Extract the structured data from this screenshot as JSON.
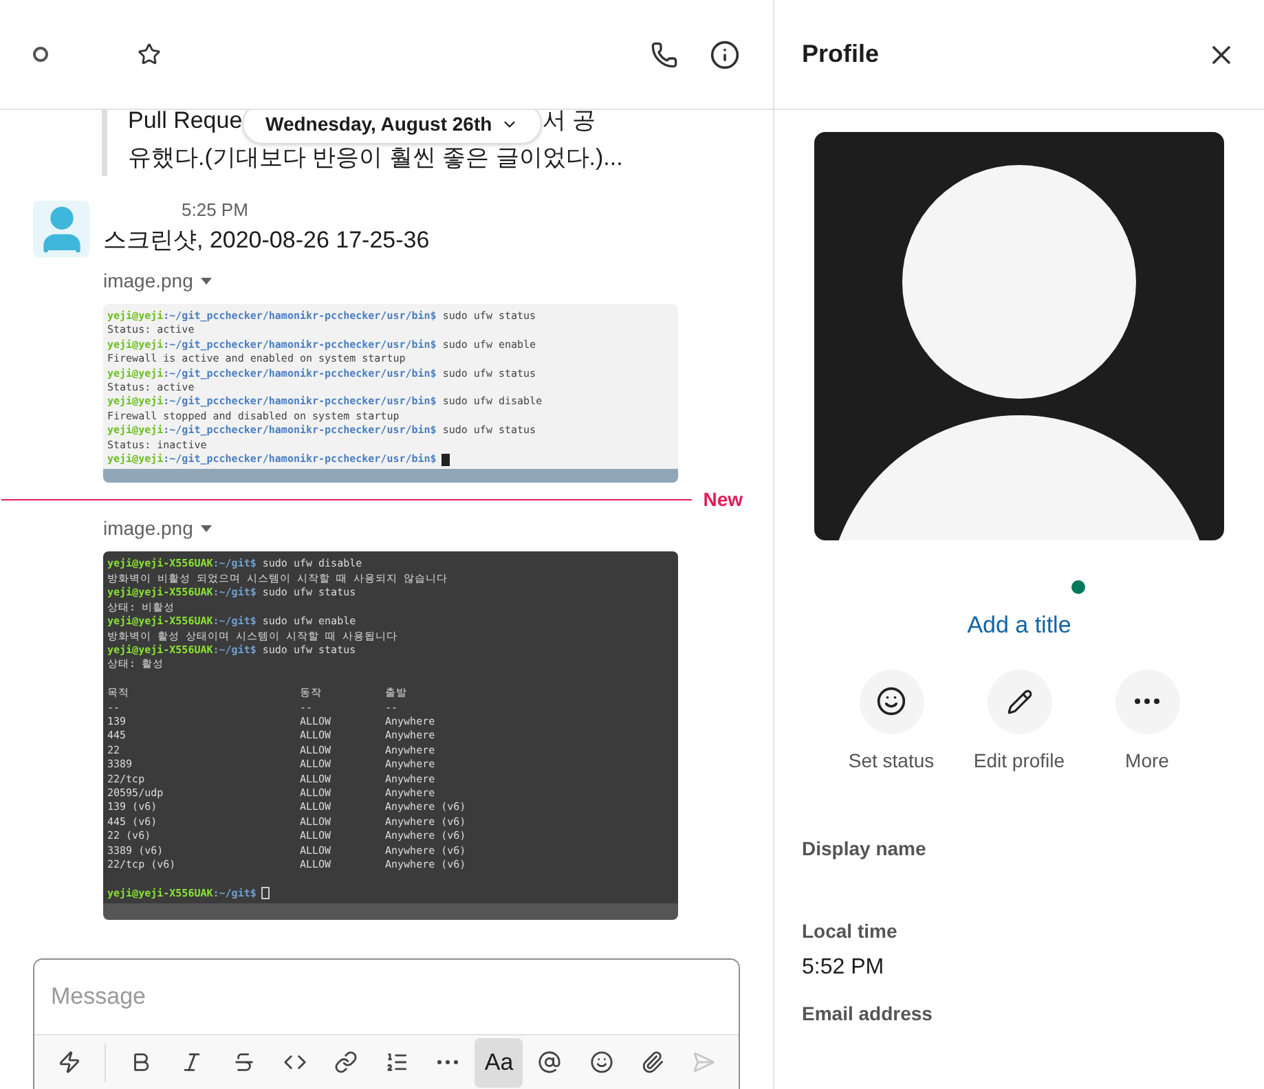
{
  "header": {
    "starred": false
  },
  "date_pill": {
    "label": "Wednesday, August 26th"
  },
  "quoted_message": {
    "line_start": "Pull Reque",
    "line_end": "서 공",
    "last_line": "유했다.(기대보다 반응이 훨씬 좋은 글이었다.)..."
  },
  "message": {
    "time": "5:25 PM",
    "text": "스크린샷, 2020-08-26 17-25-36"
  },
  "attachments": [
    {
      "name": "image.png",
      "kind": "light",
      "lines": [
        {
          "kind": "prompt",
          "user": "yeji@yeji",
          "path": ":~/git_pcchecker/hamonikr-pcchecker/usr/bin$",
          "command": " sudo ufw status"
        },
        {
          "kind": "output",
          "text": "Status: active"
        },
        {
          "kind": "prompt",
          "user": "yeji@yeji",
          "path": ":~/git_pcchecker/hamonikr-pcchecker/usr/bin$",
          "command": " sudo ufw enable"
        },
        {
          "kind": "output",
          "text": "Firewall is active and enabled on system startup"
        },
        {
          "kind": "prompt",
          "user": "yeji@yeji",
          "path": ":~/git_pcchecker/hamonikr-pcchecker/usr/bin$",
          "command": " sudo ufw status"
        },
        {
          "kind": "output",
          "text": "Status: active"
        },
        {
          "kind": "prompt",
          "user": "yeji@yeji",
          "path": ":~/git_pcchecker/hamonikr-pcchecker/usr/bin$",
          "command": " sudo ufw disable"
        },
        {
          "kind": "output",
          "text": "Firewall stopped and disabled on system startup"
        },
        {
          "kind": "prompt",
          "user": "yeji@yeji",
          "path": ":~/git_pcchecker/hamonikr-pcchecker/usr/bin$",
          "command": " sudo ufw status"
        },
        {
          "kind": "output",
          "text": "Status: inactive"
        },
        {
          "kind": "cursor",
          "user": "yeji@yeji",
          "path": ":~/git_pcchecker/hamonikr-pcchecker/usr/bin$"
        }
      ]
    },
    {
      "name": "image.png",
      "kind": "dark",
      "divider_label": "New",
      "lines": [
        {
          "kind": "prompt",
          "user": "yeji@yeji-X556UAK",
          "path": ":~/git$",
          "command": " sudo ufw disable"
        },
        {
          "kind": "output",
          "text": "방화벽이 비활성 되었으며 시스템이 시작할 때 사용되지 않습니다"
        },
        {
          "kind": "prompt",
          "user": "yeji@yeji-X556UAK",
          "path": ":~/git$",
          "command": " sudo ufw status"
        },
        {
          "kind": "output",
          "text": "상태: 비활성"
        },
        {
          "kind": "prompt",
          "user": "yeji@yeji-X556UAK",
          "path": ":~/git$",
          "command": " sudo ufw enable"
        },
        {
          "kind": "output",
          "text": "방화벽이 활성 상태이며 시스템이 시작할 때 사용됩니다"
        },
        {
          "kind": "prompt",
          "user": "yeji@yeji-X556UAK",
          "path": ":~/git$",
          "command": " sudo ufw status"
        },
        {
          "kind": "output",
          "text": "상태: 활성"
        },
        {
          "kind": "blank"
        },
        {
          "kind": "row",
          "cols": [
            "목적",
            "동작",
            "출발"
          ]
        },
        {
          "kind": "row",
          "cols": [
            "--",
            "--",
            "--"
          ]
        },
        {
          "kind": "row",
          "cols": [
            "139",
            "ALLOW",
            "Anywhere"
          ]
        },
        {
          "kind": "row",
          "cols": [
            "445",
            "ALLOW",
            "Anywhere"
          ]
        },
        {
          "kind": "row",
          "cols": [
            "22",
            "ALLOW",
            "Anywhere"
          ]
        },
        {
          "kind": "row",
          "cols": [
            "3389",
            "ALLOW",
            "Anywhere"
          ]
        },
        {
          "kind": "row",
          "cols": [
            "22/tcp",
            "ALLOW",
            "Anywhere"
          ]
        },
        {
          "kind": "row",
          "cols": [
            "20595/udp",
            "ALLOW",
            "Anywhere"
          ]
        },
        {
          "kind": "row",
          "cols": [
            "139 (v6)",
            "ALLOW",
            "Anywhere (v6)"
          ]
        },
        {
          "kind": "row",
          "cols": [
            "445 (v6)",
            "ALLOW",
            "Anywhere (v6)"
          ]
        },
        {
          "kind": "row",
          "cols": [
            "22 (v6)",
            "ALLOW",
            "Anywhere (v6)"
          ]
        },
        {
          "kind": "row",
          "cols": [
            "3389 (v6)",
            "ALLOW",
            "Anywhere (v6)"
          ]
        },
        {
          "kind": "row",
          "cols": [
            "22/tcp (v6)",
            "ALLOW",
            "Anywhere (v6)"
          ]
        },
        {
          "kind": "blank"
        },
        {
          "kind": "cursor",
          "user": "yeji@yeji-X556UAK",
          "path": ":~/git$"
        }
      ]
    }
  ],
  "composer": {
    "placeholder": "Message",
    "toolbar": [
      {
        "kind": "shortcuts",
        "selected": false
      },
      {
        "kind": "bold",
        "selected": false
      },
      {
        "kind": "italic",
        "selected": false
      },
      {
        "kind": "strike",
        "selected": false
      },
      {
        "kind": "code",
        "selected": false
      },
      {
        "kind": "link",
        "selected": false
      },
      {
        "kind": "list",
        "selected": false
      },
      {
        "kind": "more",
        "selected": false
      },
      {
        "kind": "format",
        "label": "Aa",
        "selected": true
      },
      {
        "kind": "mention",
        "selected": false
      },
      {
        "kind": "emoji",
        "selected": false
      },
      {
        "kind": "attach",
        "selected": false
      },
      {
        "kind": "send",
        "selected": false
      }
    ]
  },
  "profile": {
    "title": "Profile",
    "online": true,
    "add_title": "Add a title",
    "actions": [
      {
        "kind": "status",
        "label": "Set status"
      },
      {
        "kind": "edit",
        "label": "Edit profile"
      },
      {
        "kind": "more",
        "label": "More"
      }
    ],
    "fields": [
      {
        "label": "Display name"
      },
      {
        "label": "Local time",
        "value": "5:52 PM"
      },
      {
        "label": "Email address"
      }
    ]
  }
}
